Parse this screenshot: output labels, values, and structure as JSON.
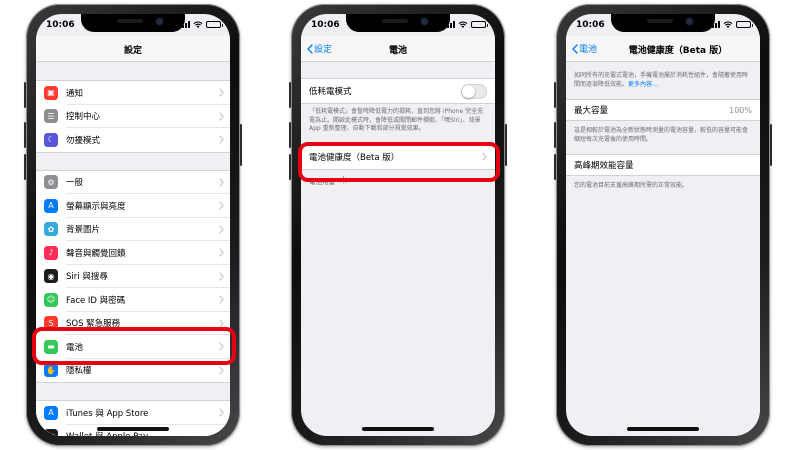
{
  "status": {
    "time": "10:06"
  },
  "colors": {
    "highlight": "#e60012",
    "ios_blue": "#007aff"
  },
  "phone1": {
    "nav_title": "設定",
    "groups": [
      [
        {
          "label": "通知",
          "icon": "notifications-icon",
          "color": "#ff3b30"
        },
        {
          "label": "控制中心",
          "icon": "control-center-icon",
          "color": "#8e8e93"
        },
        {
          "label": "勿擾模式",
          "icon": "moon-icon",
          "color": "#5856d6"
        }
      ],
      [
        {
          "label": "一般",
          "icon": "gear-icon",
          "color": "#8e8e93"
        },
        {
          "label": "螢幕顯示與亮度",
          "icon": "display-icon",
          "color": "#007aff"
        },
        {
          "label": "背景圖片",
          "icon": "wallpaper-icon",
          "color": "#34aadc"
        },
        {
          "label": "聲音與觸覺回饋",
          "icon": "sound-icon",
          "color": "#ff2d55"
        },
        {
          "label": "Siri 與搜尋",
          "icon": "siri-icon",
          "color": "#1c1c1e"
        },
        {
          "label": "Face ID 與密碼",
          "icon": "face-id-icon",
          "color": "#34c759"
        },
        {
          "label": "SOS 緊急服務",
          "icon": "sos-icon",
          "color": "#ff3b30"
        },
        {
          "label": "電池",
          "icon": "battery-icon",
          "color": "#34c759"
        },
        {
          "label": "隱私權",
          "icon": "hand-icon",
          "color": "#007aff"
        }
      ],
      [
        {
          "label": "iTunes 與 App Store",
          "icon": "app-store-icon",
          "color": "#007aff"
        },
        {
          "label": "Wallet 與 Apple Pay",
          "icon": "wallet-icon",
          "color": "#1c1c1e"
        }
      ]
    ]
  },
  "phone2": {
    "back_label": "設定",
    "nav_title": "電池",
    "low_power_label": "低耗電模式",
    "low_power_note": "「低耗電模式」會暫時降低電力的損耗，直到您將 iPhone 完全充電為止。開啟此模式時，會降低或關閉郵件擷取、「嘿Siri」、背景 App 重新整理、自動下載和部分視覺效果。",
    "battery_health_label": "電池健康度（Beta 版）",
    "battery_usage_label": "電池用量"
  },
  "phone3": {
    "back_label": "電池",
    "nav_title": "電池健康度（Beta 版）",
    "intro": "如同所有的充電式電池，手機電池屬於消耗性組件，會隨著使用時間而逐漸降低效能。",
    "intro_link": "更多內容…",
    "max_capacity_label": "最大容量",
    "max_capacity_value": "100%",
    "max_capacity_note": "這是相較於電池為全新狀態時測量的電池容量，較低的容量可能會縮短每次充電後的使用時間。",
    "peak_performance_label": "高峰期效能容量",
    "peak_performance_note": "您的電池目前支援高峰期所需的正常效能。"
  }
}
